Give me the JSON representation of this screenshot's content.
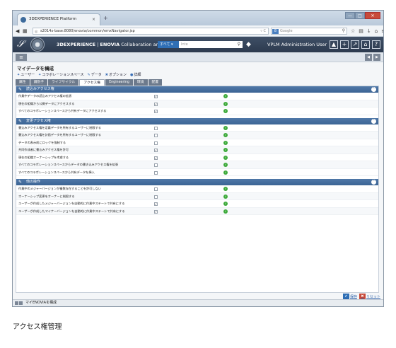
{
  "browser": {
    "tab_title": "3DEXPERIENCE Platform",
    "tab_close": "×",
    "new_tab": "+",
    "url": "s2014x-base:8080/enovia/common/emxNavigator.jsp",
    "search_engine": "Google",
    "window_buttons": [
      "—",
      "□",
      "✕"
    ]
  },
  "app_header": {
    "brand": "3DEXPERIENCE",
    "app": "ENOVIA",
    "module": "Collaboration an...",
    "scope": "すべて ▾",
    "search_placeholder": "Inte",
    "user": "VPLM Administration User"
  },
  "page": {
    "title": "マイデータを構成",
    "subnav": [
      {
        "icon": "users-icon",
        "label": "ユーザー"
      },
      {
        "icon": "collab-space-icon",
        "label": "コラボレーションスペース"
      },
      {
        "icon": "data-icon",
        "label": "データ"
      },
      {
        "icon": "options-icon",
        "label": "オプション"
      },
      {
        "icon": "details-icon",
        "label": "詳細"
      }
    ],
    "tabs": [
      "属性",
      "識別子",
      "ライフサイクル",
      "アクセス権",
      "Engineering",
      "環境",
      "配置"
    ],
    "active_tab": "アクセス権"
  },
  "sections": [
    {
      "title": "読込みアクセス権",
      "rows": [
        {
          "label": "作業中データの読込みアクセス権の拡張",
          "checked": true
        },
        {
          "label": "現在の組織から公開データにアクセスする",
          "checked": true
        },
        {
          "label": "すべてのコラボレーションスペースから共有データにアクセスする",
          "checked": true
        }
      ]
    },
    {
      "title": "変更アクセス権",
      "rows": [
        {
          "label": "書込みアクセス権を定義データを所有するユーザーに制限する",
          "checked": false
        },
        {
          "label": "書込みアクセス権を計画データを所有するユーザーに制限する",
          "checked": false
        },
        {
          "label": "データの表示前にロックを強制する",
          "checked": false
        },
        {
          "label": "共同作成者に書込みアクセス権を許可",
          "checked": true
        },
        {
          "label": "現在の組織オーナーシップを考慮する",
          "checked": true
        },
        {
          "label": "すべてのコラボレーションスペースからデータの書き込みアクセス権を拡張",
          "checked": false
        },
        {
          "label": "すべてのコラボレーションスペースから共有データを挿入",
          "checked": false
        }
      ]
    },
    {
      "title": "他の操作",
      "rows": [
        {
          "label": "作業中のメジャーバージョンが複数存在することを許可しない",
          "checked": false
        },
        {
          "label": "オーナーシップ変更をオーナーに制限する",
          "checked": false
        },
        {
          "label": "ユーザーが作成したメジャーバージョンを自動的に作業中ステートで共有にする",
          "checked": true
        },
        {
          "label": "ユーザーが作成したマイナーバージョンを自動的に作業中ステートで共有にする",
          "checked": true
        }
      ]
    }
  ],
  "actions": {
    "save": "保存",
    "reset": "リセット"
  },
  "status": {
    "label": "マイENOVIAを構成"
  },
  "caption": "アクセス権管理"
}
